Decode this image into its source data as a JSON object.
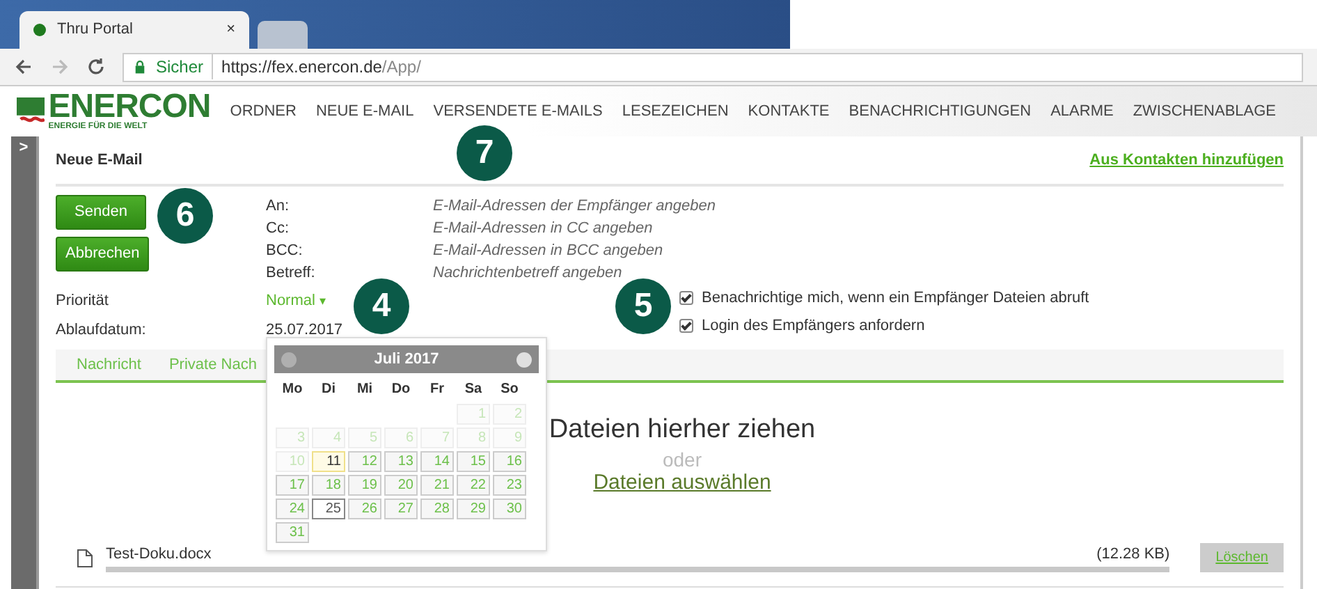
{
  "browser": {
    "tab_title": "Thru Portal",
    "tab_close": "×",
    "security": "Sicher",
    "url_host": "https://fex.enercon.de",
    "url_path": "/App/"
  },
  "brand": {
    "name": "ENERCON",
    "tagline": "ENERGIE FÜR DIE WELT"
  },
  "nav": [
    {
      "label": "ORDNER"
    },
    {
      "label": "NEUE E-MAIL"
    },
    {
      "label": "VERSENDETE E-MAILS"
    },
    {
      "label": "LESEZEICHEN"
    },
    {
      "label": "KONTAKTE"
    },
    {
      "label": "BENACHRICHTIGUNGEN"
    },
    {
      "label": "ALARME"
    },
    {
      "label": "ZWISCHENABLAGE"
    }
  ],
  "sidebar_toggle": ">",
  "compose": {
    "title": "Neue E-Mail",
    "add_from_contacts": "Aus Kontakten hinzufügen",
    "buttons": [
      "Senden",
      "Abbrechen"
    ],
    "fields": [
      {
        "label": "An:",
        "placeholder": "E-Mail-Adressen der Empfänger angeben"
      },
      {
        "label": "Cc:",
        "placeholder": "E-Mail-Adressen in CC angeben"
      },
      {
        "label": "BCC:",
        "placeholder": "E-Mail-Adressen in BCC angeben"
      },
      {
        "label": "Betreff:",
        "placeholder": "Nachrichtenbetreff angeben"
      }
    ],
    "priority": {
      "label": "Priorität",
      "value": "Normal",
      "caret": "▾"
    },
    "expiry": {
      "label": "Ablaufdatum:",
      "value": "25.07.2017"
    },
    "options": [
      {
        "label": "Benachrichtige mich, wenn ein Empfänger Dateien abruft",
        "checked": true
      },
      {
        "label": "Login des Empfängers anfordern",
        "checked": true
      }
    ],
    "tabs": [
      {
        "label": "Nachricht",
        "selected": false
      },
      {
        "label": "Private Nach",
        "selected": false
      }
    ],
    "drop": {
      "title": "Dateien hierher ziehen",
      "or": "oder",
      "choose": "Dateien auswählen"
    },
    "files": [
      {
        "name": "Test-Doku.docx",
        "size": "(12.28 KB)",
        "level": 1,
        "delete": "Löschen"
      }
    ]
  },
  "calendar": {
    "title": "Juli 2017",
    "weekdays": [
      "Mo",
      "Di",
      "Mi",
      "Do",
      "Fr",
      "Sa",
      "So"
    ],
    "weeks": [
      [
        {
          "day": "1",
          "disabled": true,
          "today": false,
          "selected": false
        },
        {
          "day": "2",
          "disabled": true,
          "today": false,
          "selected": false
        }
      ],
      [
        {
          "day": "3",
          "disabled": true,
          "today": false,
          "selected": false
        },
        {
          "day": "4",
          "disabled": true,
          "today": false,
          "selected": false
        },
        {
          "day": "5",
          "disabled": true,
          "today": false,
          "selected": false
        },
        {
          "day": "6",
          "disabled": true,
          "today": false,
          "selected": false
        },
        {
          "day": "7",
          "disabled": true,
          "today": false,
          "selected": false
        },
        {
          "day": "8",
          "disabled": true,
          "today": false,
          "selected": false
        },
        {
          "day": "9",
          "disabled": true,
          "today": false,
          "selected": false
        }
      ],
      [
        {
          "day": "10",
          "disabled": true,
          "today": false,
          "selected": false
        },
        {
          "day": "11",
          "disabled": false,
          "today": true,
          "selected": false
        },
        {
          "day": "12",
          "disabled": false,
          "today": false,
          "selected": false
        },
        {
          "day": "13",
          "disabled": false,
          "today": false,
          "selected": false
        },
        {
          "day": "14",
          "disabled": false,
          "today": false,
          "selected": false
        },
        {
          "day": "15",
          "disabled": false,
          "today": false,
          "selected": false
        },
        {
          "day": "16",
          "disabled": false,
          "today": false,
          "selected": false
        }
      ],
      [
        {
          "day": "17",
          "disabled": false,
          "today": false,
          "selected": false
        },
        {
          "day": "18",
          "disabled": false,
          "today": false,
          "selected": false
        },
        {
          "day": "19",
          "disabled": false,
          "today": false,
          "selected": false
        },
        {
          "day": "20",
          "disabled": false,
          "today": false,
          "selected": false
        },
        {
          "day": "21",
          "disabled": false,
          "today": false,
          "selected": false
        },
        {
          "day": "22",
          "disabled": false,
          "today": false,
          "selected": false
        },
        {
          "day": "23",
          "disabled": false,
          "today": false,
          "selected": false
        }
      ],
      [
        {
          "day": "24",
          "disabled": false,
          "today": false,
          "selected": false
        },
        {
          "day": "25",
          "disabled": false,
          "today": false,
          "selected": true
        },
        {
          "day": "26",
          "disabled": false,
          "today": false,
          "selected": false
        },
        {
          "day": "27",
          "disabled": false,
          "today": false,
          "selected": false
        },
        {
          "day": "28",
          "disabled": false,
          "today": false,
          "selected": false
        },
        {
          "day": "29",
          "disabled": false,
          "today": false,
          "selected": false
        },
        {
          "day": "30",
          "disabled": false,
          "today": false,
          "selected": false
        }
      ],
      [
        {
          "day": "31",
          "disabled": false,
          "today": false,
          "selected": false
        }
      ]
    ]
  },
  "callouts": [
    {
      "number": "7"
    },
    {
      "number": "6"
    },
    {
      "number": "4"
    },
    {
      "number": "5"
    }
  ]
}
